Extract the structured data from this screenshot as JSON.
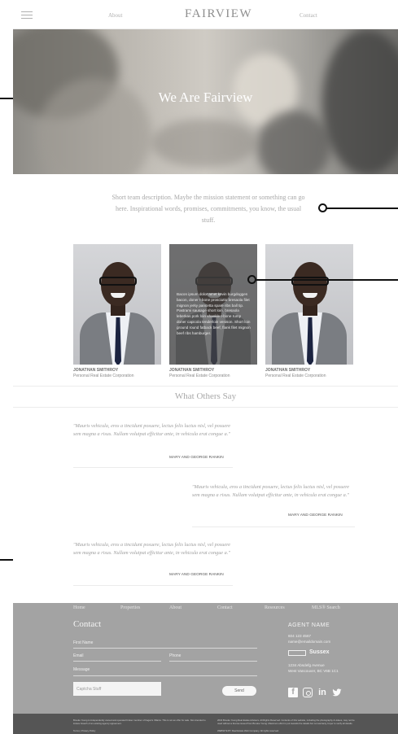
{
  "header": {
    "brand": "FAIRVIEW",
    "nav_about": "About",
    "nav_contact": "Contact"
  },
  "hero": {
    "title": "We Are Fairview"
  },
  "description": {
    "text": "Short team description. Maybe the mission statement or something can go here. Inspirational words, promises, commitments, you know, the usual stuff."
  },
  "team": {
    "members": [
      {
        "name": "JONATHAN SMITHROY",
        "role": "Personal Real Estate Corporation"
      },
      {
        "name": "JONATHAN SMITHROY",
        "role": "Personal Real Estate Corporation",
        "bio": "Bacon ipsum dolor amet kevin burgdoggen bacon, doner t-bone prosciutto bresaola filet mignon jerky pancetta spare ribs ball tip. Pastrami sausage short loin, bresaola leberkas pork loin shankle t-bone rump doner capicola tenderloin venison. Short loin ground round fatback beef, flank filet mignon beef ribs hamburger."
      },
      {
        "name": "JONATHAN SMITHROY",
        "role": "Personal Real Estate Corporation"
      }
    ]
  },
  "testimonials": {
    "title": "What Others Say",
    "items": [
      {
        "quote": "\"Mauris vehicula, eros a tincidunt posuere, lectus felis luctus nisl, vel posuere sem magna a risus. Nullam volutpat efficitur ante, in vehicula erat congue a.\"",
        "author": "MARY AND GEORGE RANKIN"
      },
      {
        "quote": "\"Mauris vehicula, eros a tincidunt posuere, lectus felis luctus nisl, vel posuere sem magna a risus. Nullam volutpat efficitur ante, in vehicula erat congue a.\"",
        "author": "MARY AND GEORGE RANKIN"
      },
      {
        "quote": "\"Mauris vehicula, eros a tincidunt posuere, lectus felis luctus nisl, vel posuere sem magna a risus. Nullam volutpat efficitur ante, in vehicula erat congue a.\"",
        "author": "MARY AND GEORGE RANKIN"
      }
    ]
  },
  "footer": {
    "nav": [
      "Home",
      "Properties",
      "About",
      "Contact",
      "Resources",
      "MLS® Search"
    ],
    "contact_title": "Contact",
    "form": {
      "first_name": "First Name",
      "email": "Email",
      "phone": "Phone",
      "message": "Message",
      "captcha": "Captcha Stuff",
      "send": "Send"
    },
    "agent": {
      "name": "AGENT NAME",
      "phone": "604 123 4567",
      "email": "name@emaildomain.com",
      "brokerage": "Sussex",
      "address1": "1234 Absdefg Avenue",
      "address2": "West Vancouver, BC V6B 1C1"
    },
    "social": [
      "facebook-icon",
      "instagram-icon",
      "linkedin-icon",
      "twitter-icon"
    ]
  },
  "legal": {
    "left": "Brooke Young is independently owned and operated broker member of Fagan's Villains. This is not an offer for sale. Not intended to induce breach of an existing agency agreement.",
    "right": "2016 Brooke Young Real Estate Advisors. All Rights Reserved. Contents of this website, including the photography & videos, may not be used without a license issued from Brooke Young. Maximum effort is put towards the details but not warranty, buyer to verify all details.",
    "privacy": "Terms | Privacy Policy",
    "credit": "WEBSITE BY Real Estate Web Company. All rights reserved."
  },
  "colors": {
    "footer_bg": "#a3a3a3",
    "legal_bg": "#555555",
    "callout": "#111111"
  }
}
